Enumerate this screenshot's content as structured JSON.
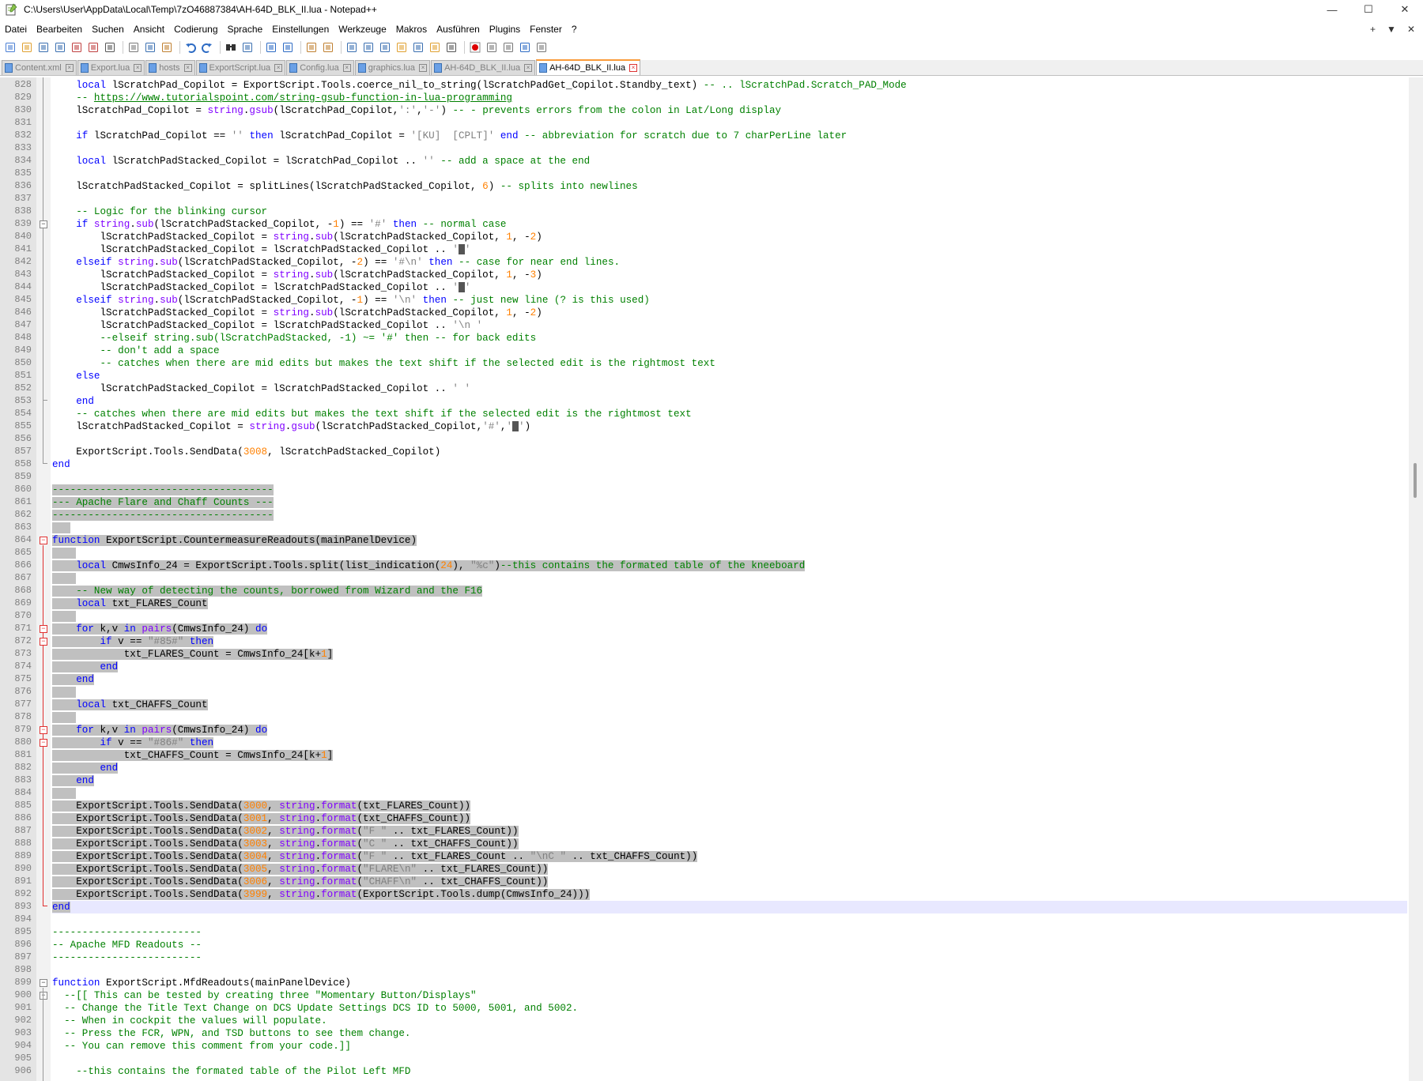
{
  "window": {
    "title": "C:\\Users\\User\\AppData\\Local\\Temp\\7zO46887384\\AH-64D_BLK_II.lua - Notepad++",
    "minimize": "—",
    "maximize": "☐",
    "close": "✕"
  },
  "menu": {
    "items": [
      "Datei",
      "Bearbeiten",
      "Suchen",
      "Ansicht",
      "Codierung",
      "Sprache",
      "Einstellungen",
      "Werkzeuge",
      "Makros",
      "Ausführen",
      "Plugins",
      "Fenster",
      "?"
    ],
    "right": [
      "+",
      "▼",
      "✕"
    ]
  },
  "toolbar": {
    "buttons": [
      "new-file-icon",
      "open-file-icon",
      "save-icon",
      "save-all-icon",
      "close-icon",
      "close-all-icon",
      "print-icon",
      "cut-icon",
      "copy-icon",
      "paste-icon",
      "undo-icon",
      "redo-icon",
      "find-icon",
      "replace-icon",
      "zoom-in-icon",
      "zoom-out-icon",
      "sync-v-icon",
      "sync-h-icon",
      "word-wrap-icon",
      "show-all-chars-icon",
      "indent-guide-icon",
      "doc-map-icon",
      "function-list-icon",
      "folder-workspace-icon",
      "monitor-icon",
      "record-macro-icon",
      "stop-macro-icon",
      "play-macro-icon",
      "run-macro-multiple-icon",
      "save-macro-icon"
    ]
  },
  "tabs": [
    {
      "label": "Content.xml",
      "active": false
    },
    {
      "label": "Export.lua",
      "active": false
    },
    {
      "label": "hosts",
      "active": false
    },
    {
      "label": "ExportScript.lua",
      "active": false
    },
    {
      "label": "Config.lua",
      "active": false
    },
    {
      "label": "graphics.lua",
      "active": false
    },
    {
      "label": "AH-64D_BLK_II.lua",
      "active": false
    },
    {
      "label": "AH-64D_BLK_II.lua",
      "active": true
    }
  ],
  "colors": {
    "keyword": "#0000ff",
    "function": "#8000ff",
    "comment": "#008000",
    "string": "#808080",
    "number": "#ff8000",
    "selection": "#c0c0c0",
    "current_line": "#e8e8ff",
    "fold_marker_active": "#e03030"
  },
  "editor": {
    "lines": [
      {
        "n": "828",
        "t": "    local lScratchPad_Copilot = ExportScript.Tools.coerce_nil_to_string(lScratchPadGet_Copilot.Standby_text) -- .. lScratchPad.Scratch_PAD_Mode"
      },
      {
        "n": "829",
        "t": "    -- https://www.tutorialspoint.com/string-gsub-function-in-lua-programming"
      },
      {
        "n": "830",
        "t": "    lScratchPad_Copilot = string.gsub(lScratchPad_Copilot,':','-') -- - prevents errors from the colon in Lat/Long display"
      },
      {
        "n": "831",
        "t": ""
      },
      {
        "n": "832",
        "t": "    if lScratchPad_Copilot == '' then lScratchPad_Copilot = '[KU]  [CPLT]' end -- abbreviation for scratch due to 7 charPerLine later"
      },
      {
        "n": "833",
        "t": ""
      },
      {
        "n": "834",
        "t": "    local lScratchPadStacked_Copilot = lScratchPad_Copilot .. '' -- add a space at the end"
      },
      {
        "n": "835",
        "t": ""
      },
      {
        "n": "836",
        "t": "    lScratchPadStacked_Copilot = splitLines(lScratchPadStacked_Copilot, 6) -- splits into newlines"
      },
      {
        "n": "837",
        "t": ""
      },
      {
        "n": "838",
        "t": "    -- Logic for the blinking cursor"
      },
      {
        "n": "839",
        "t": "    if string.sub(lScratchPadStacked_Copilot, -1) == '#' then -- normal case"
      },
      {
        "n": "840",
        "t": "        lScratchPadStacked_Copilot = string.sub(lScratchPadStacked_Copilot, 1, -2)"
      },
      {
        "n": "841",
        "t": "        lScratchPadStacked_Copilot = lScratchPadStacked_Copilot .. '█'"
      },
      {
        "n": "842",
        "t": "    elseif string.sub(lScratchPadStacked_Copilot, -2) == '#\\n' then -- case for near end lines."
      },
      {
        "n": "843",
        "t": "        lScratchPadStacked_Copilot = string.sub(lScratchPadStacked_Copilot, 1, -3)"
      },
      {
        "n": "844",
        "t": "        lScratchPadStacked_Copilot = lScratchPadStacked_Copilot .. '█'"
      },
      {
        "n": "845",
        "t": "    elseif string.sub(lScratchPadStacked_Copilot, -1) == '\\n' then -- just new line (? is this used)"
      },
      {
        "n": "846",
        "t": "        lScratchPadStacked_Copilot = string.sub(lScratchPadStacked_Copilot, 1, -2)"
      },
      {
        "n": "847",
        "t": "        lScratchPadStacked_Copilot = lScratchPadStacked_Copilot .. '\\n '"
      },
      {
        "n": "848",
        "t": "        --elseif string.sub(lScratchPadStacked, -1) ~= '#' then -- for back edits"
      },
      {
        "n": "849",
        "t": "        -- don't add a space"
      },
      {
        "n": "850",
        "t": "        -- catches when there are mid edits but makes the text shift if the selected edit is the rightmost text"
      },
      {
        "n": "851",
        "t": "    else"
      },
      {
        "n": "852",
        "t": "        lScratchPadStacked_Copilot = lScratchPadStacked_Copilot .. ' '"
      },
      {
        "n": "853",
        "t": "    end"
      },
      {
        "n": "854",
        "t": "    -- catches when there are mid edits but makes the text shift if the selected edit is the rightmost text"
      },
      {
        "n": "855",
        "t": "    lScratchPadStacked_Copilot = string.gsub(lScratchPadStacked_Copilot,'#','█')"
      },
      {
        "n": "856",
        "t": ""
      },
      {
        "n": "857",
        "t": "    ExportScript.Tools.SendData(3008, lScratchPadStacked_Copilot)"
      },
      {
        "n": "858",
        "t": "end"
      },
      {
        "n": "859",
        "t": ""
      },
      {
        "n": "860",
        "t": "-------------------------------------"
      },
      {
        "n": "861",
        "t": "--- Apache Flare and Chaff Counts ---"
      },
      {
        "n": "862",
        "t": "-------------------------------------"
      },
      {
        "n": "863",
        "t": "   "
      },
      {
        "n": "864",
        "t": "function ExportScript.CountermeasureReadouts(mainPanelDevice)"
      },
      {
        "n": "865",
        "t": "    "
      },
      {
        "n": "866",
        "t": "    local CmwsInfo_24 = ExportScript.Tools.split(list_indication(24), \"%c\")--this contains the formated table of the kneeboard"
      },
      {
        "n": "867",
        "t": "    "
      },
      {
        "n": "868",
        "t": "    -- New way of detecting the counts, borrowed from Wizard and the F16"
      },
      {
        "n": "869",
        "t": "    local txt_FLARES_Count"
      },
      {
        "n": "870",
        "t": "    "
      },
      {
        "n": "871",
        "t": "    for k,v in pairs(CmwsInfo_24) do"
      },
      {
        "n": "872",
        "t": "        if v == \"#85#\" then"
      },
      {
        "n": "873",
        "t": "            txt_FLARES_Count = CmwsInfo_24[k+1]"
      },
      {
        "n": "874",
        "t": "        end"
      },
      {
        "n": "875",
        "t": "    end"
      },
      {
        "n": "876",
        "t": "    "
      },
      {
        "n": "877",
        "t": "    local txt_CHAFFS_Count"
      },
      {
        "n": "878",
        "t": "    "
      },
      {
        "n": "879",
        "t": "    for k,v in pairs(CmwsInfo_24) do"
      },
      {
        "n": "880",
        "t": "        if v == \"#86#\" then"
      },
      {
        "n": "881",
        "t": "            txt_CHAFFS_Count = CmwsInfo_24[k+1]"
      },
      {
        "n": "882",
        "t": "        end"
      },
      {
        "n": "883",
        "t": "    end"
      },
      {
        "n": "884",
        "t": "    "
      },
      {
        "n": "885",
        "t": "    ExportScript.Tools.SendData(3000, string.format(txt_FLARES_Count))"
      },
      {
        "n": "886",
        "t": "    ExportScript.Tools.SendData(3001, string.format(txt_CHAFFS_Count))"
      },
      {
        "n": "887",
        "t": "    ExportScript.Tools.SendData(3002, string.format(\"F \" .. txt_FLARES_Count))"
      },
      {
        "n": "888",
        "t": "    ExportScript.Tools.SendData(3003, string.format(\"C \" .. txt_CHAFFS_Count))"
      },
      {
        "n": "889",
        "t": "    ExportScript.Tools.SendData(3004, string.format(\"F \" .. txt_FLARES_Count .. \"\\nC \" .. txt_CHAFFS_Count))"
      },
      {
        "n": "890",
        "t": "    ExportScript.Tools.SendData(3005, string.format(\"FLARE\\n\" .. txt_FLARES_Count))"
      },
      {
        "n": "891",
        "t": "    ExportScript.Tools.SendData(3006, string.format(\"CHAFF\\n\" .. txt_CHAFFS_Count))"
      },
      {
        "n": "892",
        "t": "    ExportScript.Tools.SendData(3999, string.format(ExportScript.Tools.dump(CmwsInfo_24)))"
      },
      {
        "n": "893",
        "t": "end"
      },
      {
        "n": "894",
        "t": ""
      },
      {
        "n": "895",
        "t": "-------------------------"
      },
      {
        "n": "896",
        "t": "-- Apache MFD Readouts --"
      },
      {
        "n": "897",
        "t": "-------------------------"
      },
      {
        "n": "898",
        "t": ""
      },
      {
        "n": "899",
        "t": "function ExportScript.MfdReadouts(mainPanelDevice)"
      },
      {
        "n": "900",
        "t": "  --[[ This can be tested by creating three \"Momentary Button/Displays\""
      },
      {
        "n": "901",
        "t": "  -- Change the Title Text Change on DCS Update Settings DCS ID to 5000, 5001, and 5002."
      },
      {
        "n": "902",
        "t": "  -- When in cockpit the values will populate."
      },
      {
        "n": "903",
        "t": "  -- Press the FCR, WPN, and TSD buttons to see them change."
      },
      {
        "n": "904",
        "t": "  -- You can remove this comment from your code.]]"
      },
      {
        "n": "905",
        "t": ""
      },
      {
        "n": "906",
        "t": "    --this contains the formated table of the Pilot Left MFD"
      }
    ]
  }
}
